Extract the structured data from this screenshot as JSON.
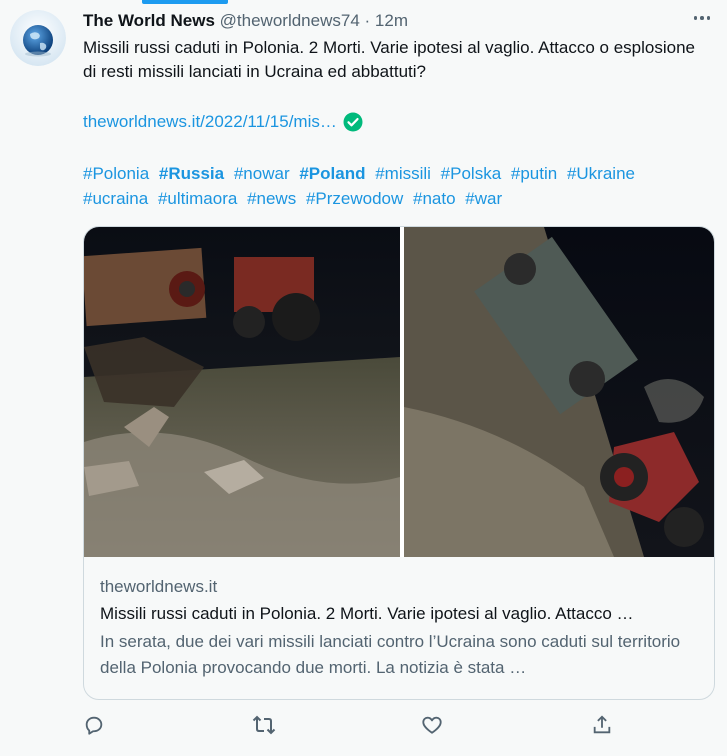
{
  "tweet": {
    "author_name": "The World News",
    "handle": "@theworldnews74",
    "separator": "·",
    "time": "12m",
    "text": "Missili russi caduti in Polonia. 2 Morti. Varie ipotesi al vaglio. Attacco o esplosione di resti missili lanciati in Ucraina ed abbattuti?",
    "link": "theworldnews.it/2022/11/15/mis…",
    "hashtags": [
      {
        "text": "#Polonia",
        "bold": false
      },
      {
        "text": "#Russia",
        "bold": true
      },
      {
        "text": "#nowar",
        "bold": false
      },
      {
        "text": "#Poland",
        "bold": true
      },
      {
        "text": "#missili",
        "bold": false
      },
      {
        "text": "#Polska",
        "bold": false
      },
      {
        "text": "#putin",
        "bold": false
      },
      {
        "text": "#Ukraine",
        "bold": false
      },
      {
        "text": "#ucraina",
        "bold": false
      },
      {
        "text": "#ultimaora",
        "bold": false
      },
      {
        "text": "#news",
        "bold": false
      },
      {
        "text": "#Przewodow",
        "bold": false
      },
      {
        "text": "#nato",
        "bold": false
      },
      {
        "text": "#war",
        "bold": false
      }
    ]
  },
  "card": {
    "domain": "theworldnews.it",
    "title": "Missili russi caduti in Polonia. 2 Morti. Varie ipotesi al vaglio. Attacco …",
    "description": "In serata, due dei vari missili lanciati contro l’Ucraina sono caduti sul territorio della Polonia provocando due morti. La notizia è stata …"
  },
  "actions": {
    "reply_icon": "reply-icon",
    "retweet_icon": "retweet-icon",
    "like_icon": "heart-icon",
    "share_icon": "share-icon"
  },
  "colors": {
    "link": "#1b95e0",
    "accent": "#1d9bf0",
    "verified": "#00ba7c",
    "muted": "#536471",
    "border": "#cfd9de"
  }
}
